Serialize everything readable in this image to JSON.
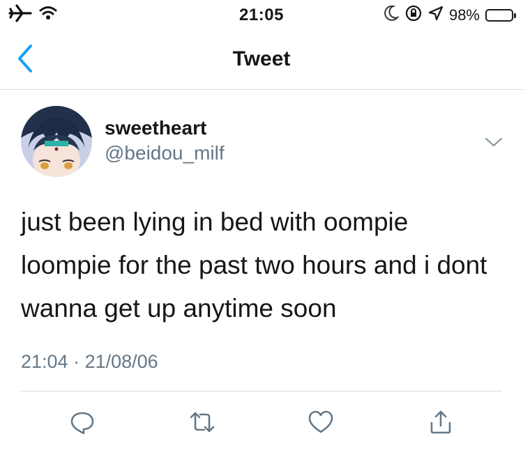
{
  "status_bar": {
    "time": "21:05",
    "battery_text": "98%",
    "battery_level": 0.98,
    "battery_color": "#f7cf3d"
  },
  "nav": {
    "title": "Tweet"
  },
  "tweet": {
    "display_name": "sweetheart",
    "handle": "@beidou_milf",
    "text": "just been lying in bed with oompie loompie for the past two hours and i dont wanna get up anytime soon",
    "time": "21:04",
    "separator": " · ",
    "date": "21/08/06"
  },
  "colors": {
    "accent": "#1da1f2",
    "secondary_text": "#657786",
    "icon": "#657786"
  },
  "icons": [
    "airplane-icon",
    "wifi-icon",
    "moon-icon",
    "orientation-lock-icon",
    "location-icon",
    "battery-icon",
    "back-chevron-icon",
    "caret-down-icon",
    "reply-icon",
    "retweet-icon",
    "like-icon",
    "share-icon"
  ]
}
